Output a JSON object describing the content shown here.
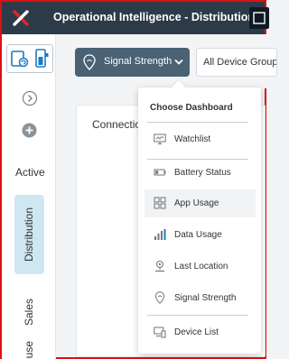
{
  "app": {
    "title": "Operational Intelligence",
    "separator": "-",
    "section": "Distribution"
  },
  "sidebar": {
    "collapse_icon": "chevron-right-circle-icon",
    "add_icon": "plus-circle-icon",
    "active_label": "Active",
    "tabs": [
      {
        "label": "Distribution",
        "selected": true
      },
      {
        "label": "Sales",
        "selected": false
      },
      {
        "label": "ouse",
        "selected": false
      }
    ]
  },
  "toolbar": {
    "dashboard_button_label": "Signal Strength",
    "device_group_label": "All Device Group"
  },
  "card": {
    "title": "Connection"
  },
  "dropdown": {
    "header": "Choose Dashboard",
    "items": [
      {
        "label": "Watchlist",
        "icon": "monitor-icon"
      },
      {
        "label": "Battery Status",
        "icon": "battery-icon"
      },
      {
        "label": "App Usage",
        "icon": "grid-icon",
        "hovered": true
      },
      {
        "label": "Data Usage",
        "icon": "bar-chart-icon"
      },
      {
        "label": "Last Location",
        "icon": "location-icon"
      },
      {
        "label": "Signal Strength",
        "icon": "signal-pin-icon"
      },
      {
        "label": "Device List",
        "icon": "device-list-icon"
      }
    ]
  },
  "colors": {
    "header_bg": "#2d3a47",
    "accent_button": "#4a6274",
    "selected_tab": "#cfe6f3",
    "logo_red": "#e0262a",
    "icon_blue": "#1a7bc0"
  }
}
